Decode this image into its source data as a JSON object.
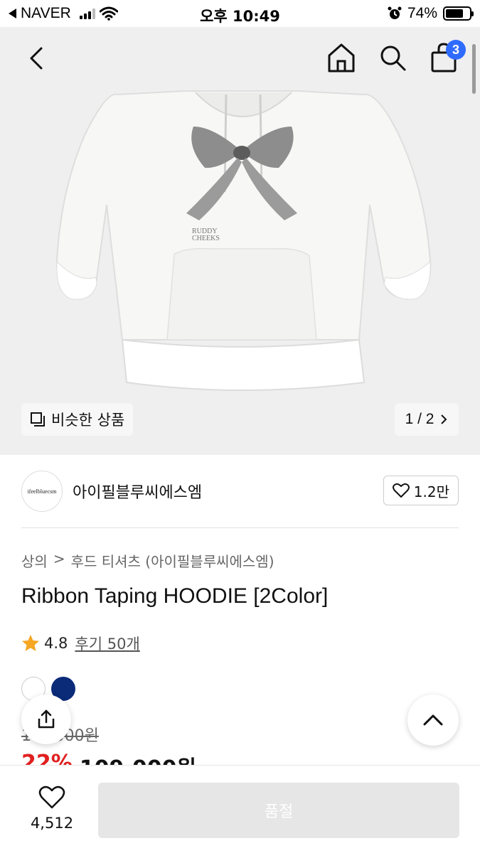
{
  "status_bar": {
    "carrier": "NAVER",
    "time": "오후 10:49",
    "battery_percent": "74%",
    "battery_level": 0.74
  },
  "header": {
    "back_icon": "chevron-left-icon",
    "home_icon": "home-icon",
    "search_icon": "search-icon",
    "cart_icon": "shopping-bag-icon",
    "cart_count": "3",
    "badge_color": "#2f6bff"
  },
  "gallery": {
    "similar_label": "비슷한 상품",
    "page_indicator": "1 / 2",
    "current_page": 1,
    "total_pages": 2
  },
  "brand": {
    "logo_text": "ifeelbluecsm",
    "name": "아이필블루씨에스엠",
    "likes": "1.2만"
  },
  "breadcrumb": {
    "category": "상의",
    "separator": ">",
    "subcategory": "후드 티셔츠 (아이필블루씨에스엠)"
  },
  "product": {
    "title": "Ribbon Taping HOODIE [2Color]",
    "rating": "4.8",
    "reviews_label": "후기 50개",
    "swatches": [
      {
        "color": "#ffffff",
        "border": "#cccccc"
      },
      {
        "color": "#0b2a78",
        "border": "#0b2a78"
      }
    ],
    "original_price": "1?0,000원",
    "discount": "22%",
    "sale_price": "109,000원",
    "discount_color": "#e02020"
  },
  "bottom_bar": {
    "wish_count": "4,512",
    "buy_label": "품절"
  }
}
